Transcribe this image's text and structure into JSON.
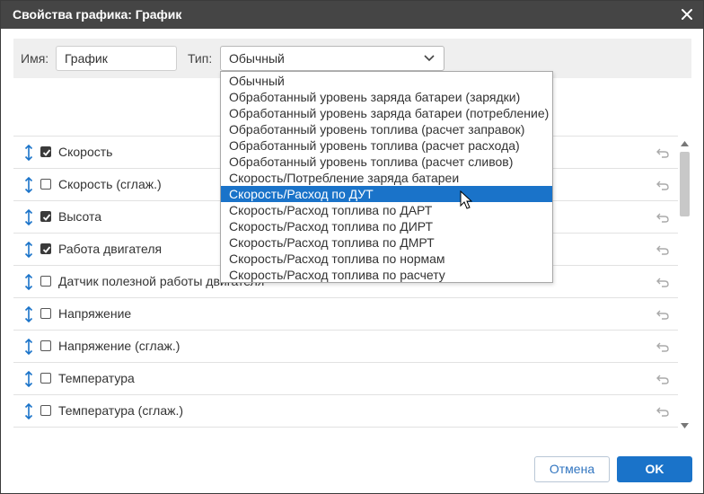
{
  "title": "Свойства графика: График",
  "form": {
    "name_label": "Имя:",
    "name_value": "График",
    "type_label": "Тип:",
    "type_value": "Обычный"
  },
  "type_options": [
    "Обычный",
    "Обработанный уровень заряда батареи (зарядки)",
    "Обработанный уровень заряда батареи (потребление)",
    "Обработанный уровень топлива (расчет заправок)",
    "Обработанный уровень топлива (расчет расхода)",
    "Обработанный уровень топлива (расчет сливов)",
    "Скорость/Потребление заряда батареи",
    "Скорость/Расход по ДУТ",
    "Скорость/Расход топлива по ДАРТ",
    "Скорость/Расход топлива по ДИРТ",
    "Скорость/Расход топлива по ДМРТ",
    "Скорость/Расход топлива по нормам",
    "Скорость/Расход топлива по расчету"
  ],
  "highlighted_option": "Скорость/Расход по ДУТ",
  "rows": [
    {
      "label": "Скорость",
      "checked": true
    },
    {
      "label": "Скорость (сглаж.)",
      "checked": false
    },
    {
      "label": "Высота",
      "checked": true
    },
    {
      "label": "Работа двигателя",
      "checked": true
    },
    {
      "label": "Датчик полезной работы двигателя",
      "checked": false
    },
    {
      "label": "Напряжение",
      "checked": false
    },
    {
      "label": "Напряжение (сглаж.)",
      "checked": false
    },
    {
      "label": "Температура",
      "checked": false
    },
    {
      "label": "Температура (сглаж.)",
      "checked": false
    }
  ],
  "buttons": {
    "cancel": "Отмена",
    "ok": "OK"
  },
  "colors": {
    "titlebar": "#454545",
    "accent": "#1a73c9",
    "drag_icon": "#1a73c9"
  },
  "icons": {
    "close": "close-icon",
    "chevron": "chevron-down-icon",
    "drag": "drag-handle-icon",
    "reset": "undo-icon"
  }
}
